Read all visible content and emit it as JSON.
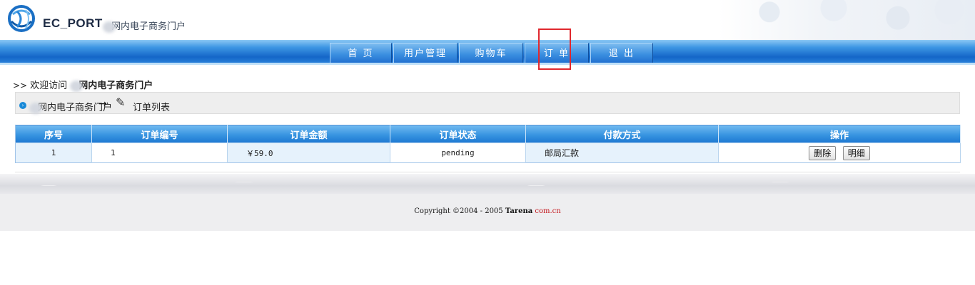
{
  "header": {
    "brand": "EC_PORT",
    "brand_cn": "网内电子商务门户",
    "logo_icon": "globe-logo-icon"
  },
  "nav": {
    "items": [
      {
        "label": "首 页"
      },
      {
        "label": "用户管理"
      },
      {
        "label": "购物车"
      },
      {
        "label": "订 单"
      },
      {
        "label": "退 出"
      }
    ],
    "highlight_color": "#e0282e"
  },
  "welcome": {
    "prefix": "欢迎访问",
    "site": "网内电子商务门户"
  },
  "breadcrumb": {
    "site": "网内电子商务门户",
    "arrow": "→",
    "page": "订单列表"
  },
  "table": {
    "columns": [
      "序号",
      "订单编号",
      "订单金额",
      "订单状态",
      "付款方式",
      "操作"
    ],
    "rows": [
      {
        "index": "1",
        "order_no": "1",
        "amount": "￥59.0",
        "status": "pending",
        "payment": "邮局汇款",
        "actions": {
          "delete": "删除",
          "detail": "明细"
        }
      }
    ]
  },
  "footer": {
    "copyright": "Copyright ©2004 - 2005 ",
    "brand": "Tarena",
    "domain": " com.cn"
  },
  "colors": {
    "nav_blue": "#1566c8",
    "header_blue": "#3794e0",
    "accent_red": "#c4161c"
  }
}
